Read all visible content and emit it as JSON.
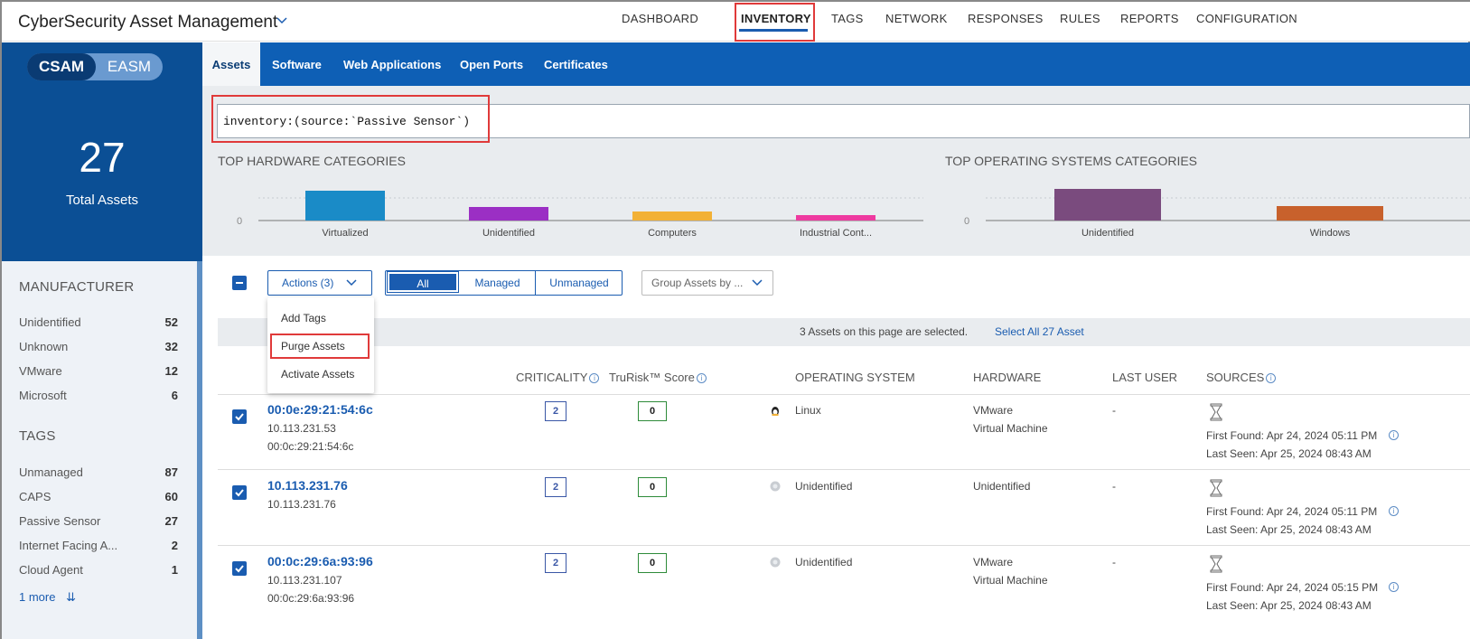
{
  "app": {
    "title": "CyberSecurity Asset Management"
  },
  "nav": [
    "DASHBOARD",
    "INVENTORY",
    "TAGS",
    "NETWORK",
    "RESPONSES",
    "RULES",
    "REPORTS",
    "CONFIGURATION"
  ],
  "toggle": {
    "left": "CSAM",
    "right": "EASM"
  },
  "summary": {
    "count": "27",
    "label": "Total Assets"
  },
  "tabs": [
    "Assets",
    "Software",
    "Web Applications",
    "Open Ports",
    "Certificates"
  ],
  "search": {
    "query": "inventory:(source:`Passive Sensor`)"
  },
  "hardware_chart": {
    "title": "TOP HARDWARE CATEGORIES",
    "zero": "0",
    "categories": [
      "Virtualized",
      "Unidentified",
      "Computers",
      "Industrial Cont..."
    ],
    "colors": [
      "#1a8bc7",
      "#9b2fc4",
      "#f2b136",
      "#ee3aa0"
    ]
  },
  "os_chart": {
    "title": "TOP OPERATING SYSTEMS CATEGORIES",
    "zero": "0",
    "categories": [
      "Unidentified",
      "Windows"
    ],
    "colors": [
      "#7a4b7e",
      "#c8612c"
    ]
  },
  "manufacturer": {
    "title": "MANUFACTURER",
    "items": [
      {
        "label": "Unidentified",
        "count": "52"
      },
      {
        "label": "Unknown",
        "count": "32"
      },
      {
        "label": "VMware",
        "count": "12"
      },
      {
        "label": "Microsoft",
        "count": "6"
      }
    ]
  },
  "tags": {
    "title": "TAGS",
    "items": [
      {
        "label": "Unmanaged",
        "count": "87"
      },
      {
        "label": "CAPS",
        "count": "60"
      },
      {
        "label": "Passive Sensor",
        "count": "27"
      },
      {
        "label": "Internet Facing A...",
        "count": "2"
      },
      {
        "label": "Cloud Agent",
        "count": "1"
      }
    ],
    "more": "1 more"
  },
  "toolbar": {
    "actions": "Actions (3)",
    "segments": [
      "All",
      "Managed",
      "Unmanaged"
    ],
    "group_by": "Group Assets by ..."
  },
  "actions_menu": [
    "Add Tags",
    "Purge Assets",
    "Activate Assets"
  ],
  "selection": {
    "text": "3 Assets on this page are selected.",
    "link": "Select All 27 Asset"
  },
  "columns": {
    "criticality": "CRITICALITY",
    "trurisk": "TruRisk™ Score",
    "os": "OPERATING SYSTEM",
    "hardware": "HARDWARE",
    "last_user": "LAST USER",
    "sources": "SOURCES"
  },
  "rows": [
    {
      "name": "00:0e:29:21:54:6c",
      "sub1": "10.113.231.53",
      "sub2": "00:0c:29:21:54:6c",
      "criticality": "2",
      "trurisk": "0",
      "os": "Linux",
      "hw1": "VMware",
      "hw2": "Virtual Machine",
      "last_user": "-",
      "first_found": "First Found: Apr 24, 2024 05:11 PM",
      "last_seen": "Last Seen: Apr 25, 2024 08:43 AM"
    },
    {
      "name": "10.113.231.76",
      "sub1": "10.113.231.76",
      "sub2": "",
      "criticality": "2",
      "trurisk": "0",
      "os": "Unidentified",
      "hw1": "Unidentified",
      "hw2": "",
      "last_user": "-",
      "first_found": "First Found: Apr 24, 2024 05:11 PM",
      "last_seen": "Last Seen: Apr 25, 2024 08:43 AM"
    },
    {
      "name": "00:0c:29:6a:93:96",
      "sub1": "10.113.231.107",
      "sub2": "00:0c:29:6a:93:96",
      "criticality": "2",
      "trurisk": "0",
      "os": "Unidentified",
      "hw1": "VMware",
      "hw2": "Virtual Machine",
      "last_user": "-",
      "first_found": "First Found: Apr 24, 2024 05:15 PM",
      "last_seen": "Last Seen: Apr 25, 2024 08:43 AM"
    }
  ]
}
